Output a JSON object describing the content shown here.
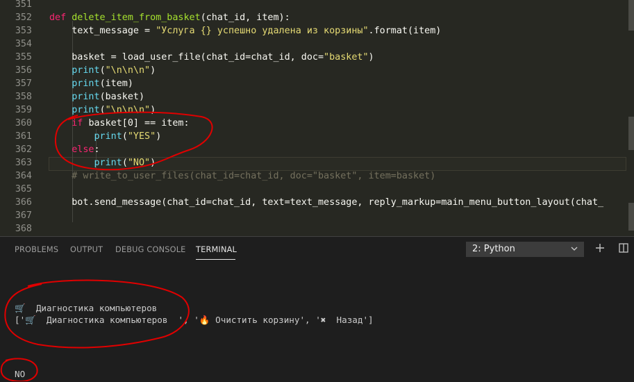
{
  "editor": {
    "lines": [
      {
        "num": "351",
        "segs": []
      },
      {
        "num": "352",
        "segs": [
          [
            "kw",
            "def "
          ],
          [
            "fn",
            "delete_item_from_basket"
          ],
          [
            "",
            "(chat_id, item):"
          ]
        ]
      },
      {
        "num": "353",
        "segs": [
          [
            "",
            "    text_message = "
          ],
          [
            "st",
            "\"Услуга {} успешно удалена из корзины\""
          ],
          [
            "",
            ".format(item)"
          ]
        ]
      },
      {
        "num": "354",
        "segs": []
      },
      {
        "num": "355",
        "segs": [
          [
            "",
            "    basket = load_user_file(chat_id=chat_id, doc="
          ],
          [
            "st",
            "\"basket\""
          ],
          [
            "",
            ")"
          ]
        ]
      },
      {
        "num": "356",
        "segs": [
          [
            "bi",
            "    print"
          ],
          [
            "",
            "("
          ],
          [
            "st",
            "\"\\n\\n\\n\""
          ],
          [
            "",
            ")"
          ]
        ]
      },
      {
        "num": "357",
        "segs": [
          [
            "bi",
            "    print"
          ],
          [
            "",
            "(item)"
          ]
        ]
      },
      {
        "num": "358",
        "segs": [
          [
            "bi",
            "    print"
          ],
          [
            "",
            "(basket)"
          ]
        ]
      },
      {
        "num": "359",
        "segs": [
          [
            "bi",
            "    print"
          ],
          [
            "",
            "("
          ],
          [
            "st",
            "\"\\n\\n\\n\""
          ],
          [
            "",
            ")"
          ]
        ]
      },
      {
        "num": "360",
        "segs": [
          [
            "kw",
            "    if "
          ],
          [
            "",
            "basket[0] == item:"
          ]
        ]
      },
      {
        "num": "361",
        "segs": [
          [
            "bi",
            "        print"
          ],
          [
            "",
            "("
          ],
          [
            "st",
            "\"YES\""
          ],
          [
            "",
            ")"
          ]
        ]
      },
      {
        "num": "362",
        "segs": [
          [
            "kw",
            "    else"
          ],
          [
            "",
            ":"
          ]
        ]
      },
      {
        "num": "363",
        "segs": [
          [
            "bi",
            "        print"
          ],
          [
            "",
            "("
          ],
          [
            "st",
            "\"NO\""
          ],
          [
            "",
            ")"
          ]
        ]
      },
      {
        "num": "364",
        "segs": [
          [
            "cm",
            "    # write_to_user_files(chat_id=chat_id, doc=\"basket\", item=basket)"
          ]
        ]
      },
      {
        "num": "365",
        "segs": []
      },
      {
        "num": "366",
        "segs": [
          [
            "",
            "    bot.send_message(chat_id=chat_id, text=text_message, reply_markup=main_menu_button_layout(chat_"
          ]
        ]
      },
      {
        "num": "367",
        "segs": []
      },
      {
        "num": "368",
        "segs": []
      }
    ]
  },
  "panel": {
    "tabs": [
      "PROBLEMS",
      "OUTPUT",
      "DEBUG CONSOLE",
      "TERMINAL"
    ],
    "terminal_selector": "2: Python",
    "add_icon": "plus-icon",
    "split_icon": "split-terminal-icon",
    "terminal_lines": [
      "🛒  Диагностика компьютеров",
      "['🛒  Диагностика компьютеров  ', '🔥 Очистить корзину', '✖  Назад']",
      "NO"
    ]
  },
  "colors": {
    "editor_bg": "#272822",
    "keyword": "#f92672",
    "function": "#a6e22e",
    "builtin": "#66d9ef",
    "string": "#e6db74",
    "comment": "#75715e",
    "annotation": "#e00000"
  }
}
